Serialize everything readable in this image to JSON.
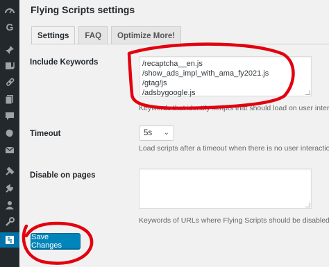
{
  "sidebar": {
    "icons": [
      "dashboard-icon",
      "google-icon",
      "pin-icon",
      "media-icon",
      "links-icon",
      "pages-icon",
      "comments-icon",
      "appearance-icon",
      "email-icon",
      "tools-icon",
      "plugins-icon",
      "users-icon",
      "wrench-icon",
      "settings-icon"
    ],
    "active_color": "#0073aa",
    "background": "#23282d"
  },
  "page": {
    "title": "Flying Scripts settings"
  },
  "tabs": [
    {
      "label": "Settings",
      "active": true
    },
    {
      "label": "FAQ",
      "active": false
    },
    {
      "label": "Optimize More!",
      "active": false
    }
  ],
  "fields": {
    "include_keywords": {
      "label": "Include Keywords",
      "lines": [
        "/recaptcha__en.js",
        "/show_ads_impl_with_ama_fy2021.js",
        "/gtag/js",
        "/adsbygoogle.js"
      ],
      "description": "Keywords that identify scripts that should load on user interact"
    },
    "timeout": {
      "label": "Timeout",
      "value": "5s",
      "description": "Load scripts after a timeout when there is no user interaction"
    },
    "disable_on_pages": {
      "label": "Disable on pages",
      "value": "",
      "description": "Keywords of URLs where Flying Scripts should be disabled"
    }
  },
  "save_button": {
    "label": "Save Changes",
    "color": "#0085ba"
  },
  "annotation_color": "#e3000f"
}
